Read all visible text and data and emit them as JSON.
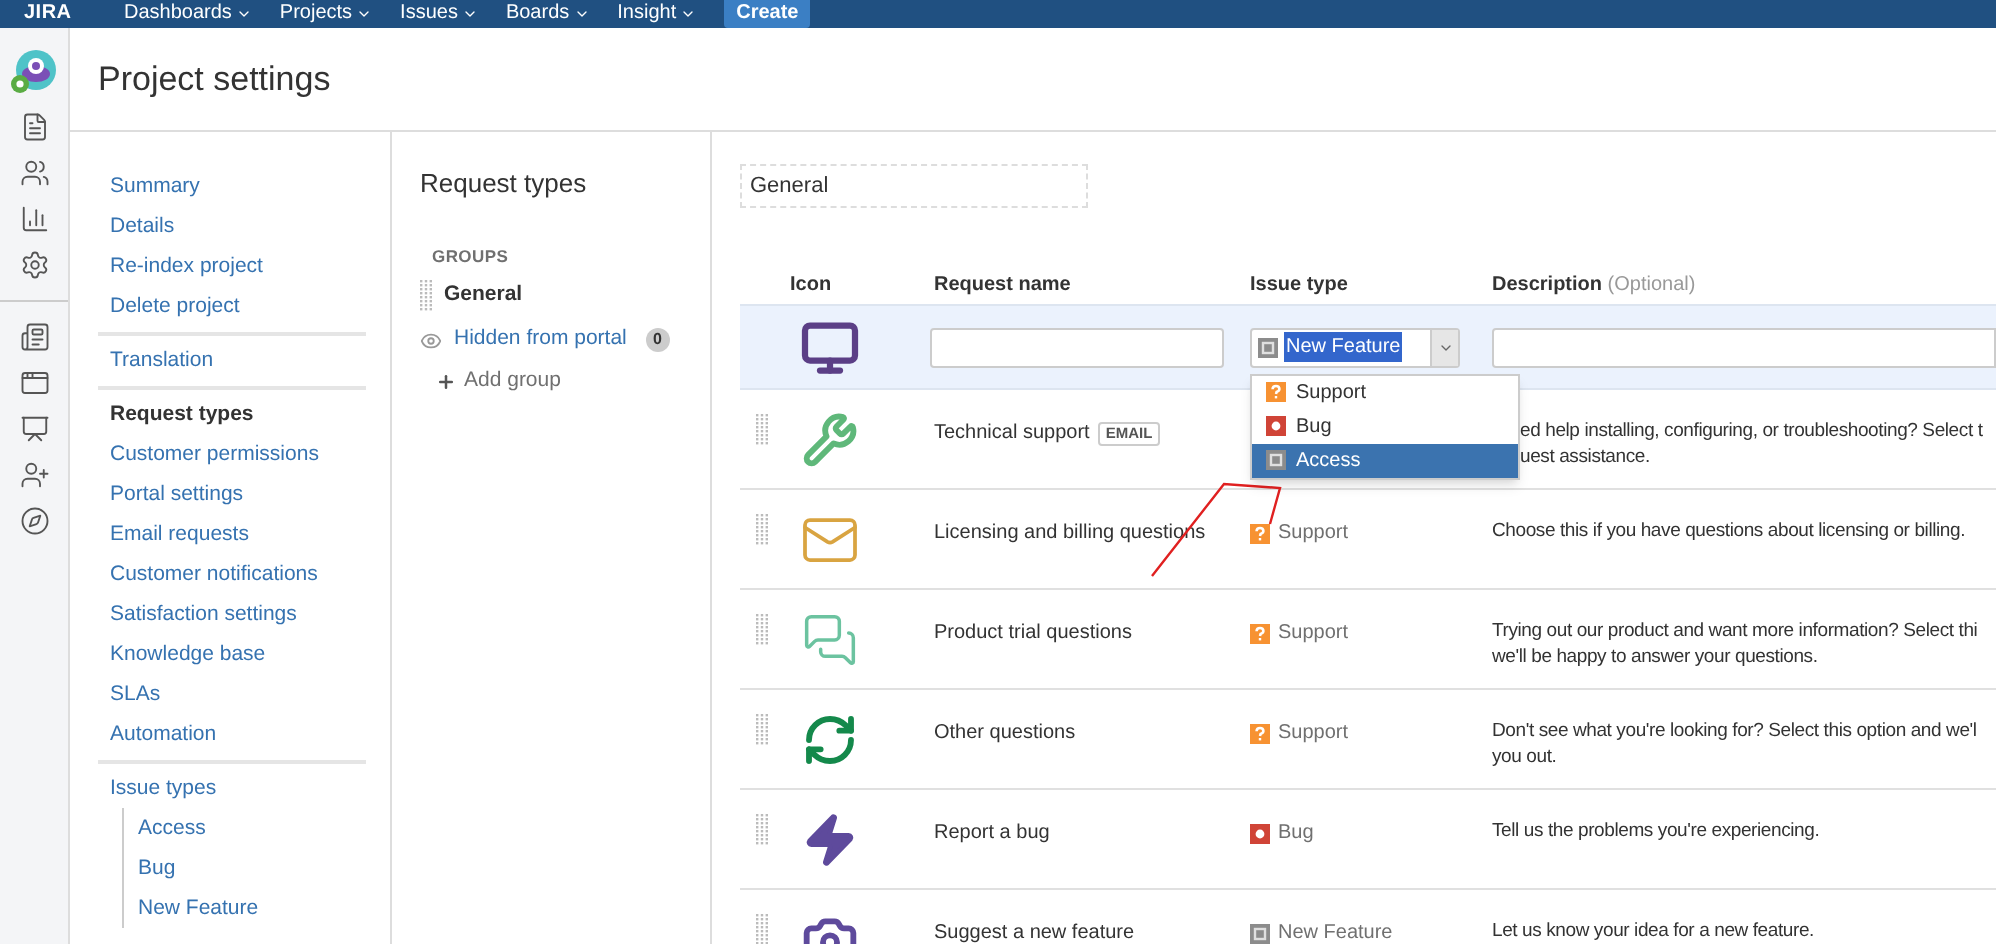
{
  "top_nav": {
    "logo": "JIRA",
    "items": [
      "Dashboards",
      "Projects",
      "Issues",
      "Boards",
      "Insight"
    ],
    "create_button": "Create"
  },
  "page_title": "Project settings",
  "settings_nav": {
    "sections": [
      {
        "items": [
          {
            "label": "Summary",
            "selected": false
          },
          {
            "label": "Details",
            "selected": false
          },
          {
            "label": "Re-index project",
            "selected": false
          },
          {
            "label": "Delete project",
            "selected": false
          }
        ]
      },
      {
        "items": [
          {
            "label": "Translation",
            "selected": false
          }
        ]
      },
      {
        "items": [
          {
            "label": "Request types",
            "selected": true
          },
          {
            "label": "Customer permissions",
            "selected": false
          },
          {
            "label": "Portal settings",
            "selected": false
          },
          {
            "label": "Email requests",
            "selected": false
          },
          {
            "label": "Customer notifications",
            "selected": false
          },
          {
            "label": "Satisfaction settings",
            "selected": false
          },
          {
            "label": "Knowledge base",
            "selected": false
          },
          {
            "label": "SLAs",
            "selected": false
          },
          {
            "label": "Automation",
            "selected": false
          }
        ]
      },
      {
        "items": [
          {
            "label": "Issue types",
            "selected": false,
            "children": [
              {
                "label": "Access",
                "selected": false
              },
              {
                "label": "Bug",
                "selected": false
              },
              {
                "label": "New Feature",
                "selected": false
              }
            ]
          }
        ]
      }
    ]
  },
  "groups_panel": {
    "title": "Request types",
    "groups_label": "GROUPS",
    "groups": [
      {
        "kind": "group",
        "label": "General",
        "selected": true
      },
      {
        "kind": "hidden",
        "label": "Hidden from portal",
        "count": "0",
        "selected": false
      }
    ],
    "add_group": "Add group"
  },
  "group_name_field": {
    "value": "General"
  },
  "table": {
    "columns": [
      {
        "label": "Icon"
      },
      {
        "label": "Request name"
      },
      {
        "label": "Issue type"
      },
      {
        "label": "Description",
        "note": "(Optional)"
      }
    ],
    "new_row": {
      "kind": "monitor",
      "issue_type": {
        "value": "New Feature",
        "kind": "feature"
      },
      "dropdown": {
        "options": [
          {
            "label": "Support",
            "kind": "support",
            "selected": false
          },
          {
            "label": "Bug",
            "kind": "bug",
            "selected": false
          },
          {
            "label": "Access",
            "kind": "feature",
            "selected": true
          }
        ]
      }
    },
    "rows": [
      {
        "kind": "wrench",
        "name": "Technical support",
        "badge": "EMAIL",
        "partly_hidden": true,
        "description": [
          "ed help installing, configuring, or troubleshooting? Select t",
          "uest assistance."
        ]
      },
      {
        "kind": "envelope",
        "name": "Licensing and billing questions",
        "issue_type": {
          "label": "Support",
          "kind": "support"
        },
        "partly_hidden": false,
        "description": [
          "Choose this if you have questions about licensing or billing."
        ]
      },
      {
        "kind": "chat",
        "name": "Product trial questions",
        "issue_type": {
          "label": "Support",
          "kind": "support"
        },
        "partly_hidden": false,
        "description": [
          "Trying out our product and want more information? Select thi",
          "we'll be happy to answer your questions."
        ]
      },
      {
        "kind": "refresh",
        "name": "Other questions",
        "issue_type": {
          "label": "Support",
          "kind": "support"
        },
        "partly_hidden": false,
        "description": [
          "Don't see what you're looking for? Select this option and we'l",
          "you out."
        ]
      },
      {
        "kind": "bolt",
        "name": "Report a bug",
        "issue_type": {
          "label": "Bug",
          "kind": "bug"
        },
        "partly_hidden": false,
        "description": [
          "Tell us the problems you're experiencing."
        ]
      },
      {
        "kind": "camera",
        "name": "Suggest a new feature",
        "issue_type": {
          "label": "New Feature",
          "kind": "feature"
        },
        "partly_hidden": false,
        "description": [
          "Let us know your idea for a new feature."
        ]
      }
    ]
  }
}
